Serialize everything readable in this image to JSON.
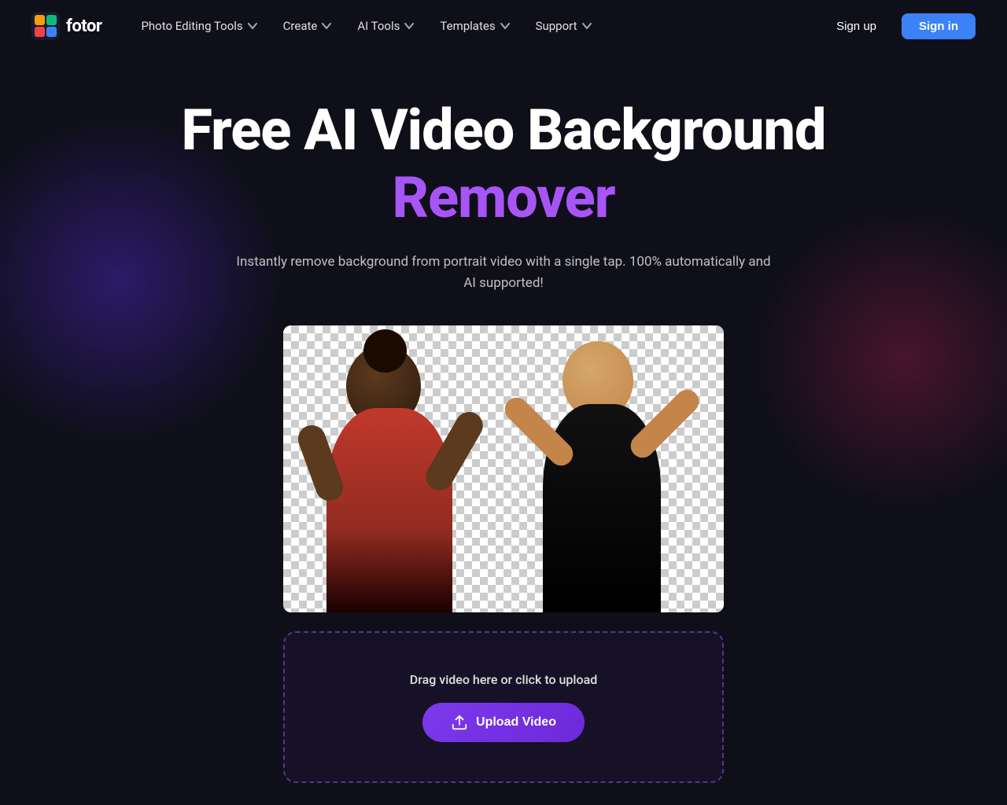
{
  "logo": {
    "text": "fotor"
  },
  "nav": {
    "items": [
      {
        "label": "Photo Editing Tools",
        "id": "photo-editing-tools"
      },
      {
        "label": "Create",
        "id": "create"
      },
      {
        "label": "AI Tools",
        "id": "ai-tools"
      },
      {
        "label": "Templates",
        "id": "templates"
      },
      {
        "label": "Support",
        "id": "support"
      }
    ],
    "signup_label": "Sign up",
    "signin_label": "Sign in"
  },
  "hero": {
    "title_line1": "Free AI Video Background",
    "title_line2": "Remover",
    "subtitle": "Instantly remove background from portrait video with a single tap. 100% automatically and AI supported!"
  },
  "upload": {
    "drag_text": "Drag video here or click to upload",
    "button_label": "Upload Video"
  }
}
